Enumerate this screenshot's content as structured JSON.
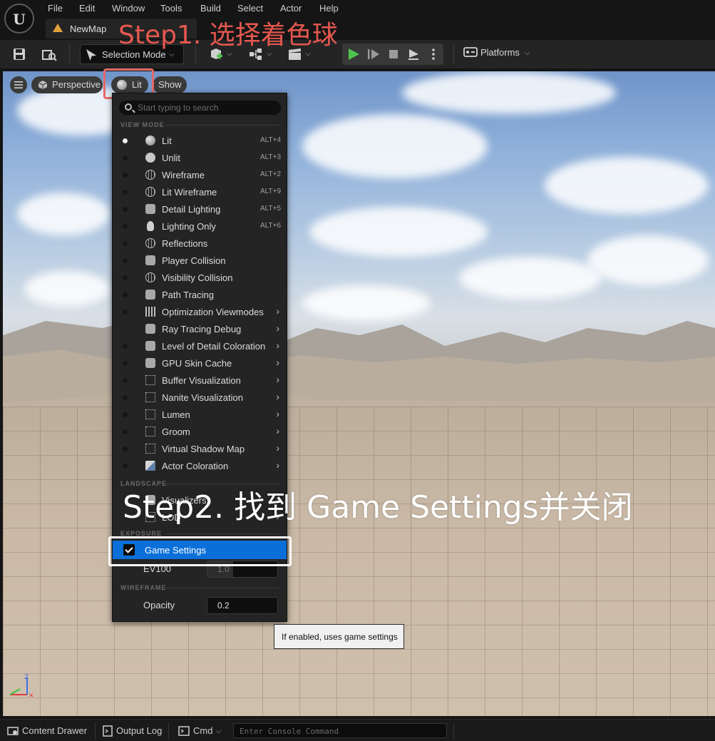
{
  "menubar": {
    "logo_letter": "U",
    "items": [
      "File",
      "Edit",
      "Window",
      "Tools",
      "Build",
      "Select",
      "Actor",
      "Help"
    ]
  },
  "tab": {
    "title": "NewMap"
  },
  "toolbar": {
    "selection_mode": "Selection Mode",
    "platforms": "Platforms",
    "icons": [
      "save-icon",
      "browse-icon",
      "add-actor-icon",
      "blueprint-icon",
      "cinematics-icon",
      "play-icon",
      "advance-icon",
      "stop-icon",
      "eject-icon",
      "more-icon",
      "platforms-icon"
    ]
  },
  "viewport": {
    "perspective": "Perspective",
    "lit": "Lit",
    "show": "Show"
  },
  "annotations": {
    "step1": "Step1. 选择着色球",
    "step2": "Step2. 找到 Game Settings并关闭"
  },
  "view_menu": {
    "search_placeholder": "Start typing to search",
    "sections": {
      "view_mode": "VIEW MODE",
      "landscape": "LANDSCAPE",
      "exposure": "EXPOSURE",
      "wireframe": "WIREFRAME"
    },
    "items": [
      {
        "label": "Lit",
        "shortcut": "ALT+4",
        "icon": "lit-sphere-icon",
        "selected": true
      },
      {
        "label": "Unlit",
        "shortcut": "ALT+3",
        "icon": "unlit-sphere-icon"
      },
      {
        "label": "Wireframe",
        "shortcut": "ALT+2",
        "icon": "wireframe-icon"
      },
      {
        "label": "Lit Wireframe",
        "shortcut": "ALT+9",
        "icon": "lit-wireframe-icon"
      },
      {
        "label": "Detail Lighting",
        "shortcut": "ALT+5",
        "icon": "detail-lighting-icon"
      },
      {
        "label": "Lighting Only",
        "shortcut": "ALT+6",
        "icon": "lightbulb-icon"
      },
      {
        "label": "Reflections",
        "shortcut": "",
        "icon": "reflections-icon"
      },
      {
        "label": "Player Collision",
        "shortcut": "",
        "icon": "player-collision-icon"
      },
      {
        "label": "Visibility Collision",
        "shortcut": "",
        "icon": "visibility-collision-icon"
      },
      {
        "label": "Path Tracing",
        "shortcut": "",
        "icon": "path-tracing-icon"
      },
      {
        "label": "Optimization Viewmodes",
        "shortcut": "",
        "icon": "optimization-icon",
        "submenu": true
      },
      {
        "label": "Ray Tracing Debug",
        "shortcut": "",
        "icon": "ray-tracing-icon",
        "submenu": true,
        "no_bullet": true
      },
      {
        "label": "Level of Detail Coloration",
        "shortcut": "",
        "icon": "lod-coloration-icon",
        "submenu": true
      },
      {
        "label": "GPU Skin Cache",
        "shortcut": "",
        "icon": "skin-cache-icon",
        "submenu": true
      },
      {
        "label": "Buffer Visualization",
        "shortcut": "",
        "icon": "buffer-icon",
        "submenu": true
      },
      {
        "label": "Nanite Visualization",
        "shortcut": "",
        "icon": "nanite-icon",
        "submenu": true
      },
      {
        "label": "Lumen",
        "shortcut": "",
        "icon": "lumen-icon",
        "submenu": true
      },
      {
        "label": "Groom",
        "shortcut": "",
        "icon": "groom-icon",
        "submenu": true
      },
      {
        "label": "Virtual Shadow Map",
        "shortcut": "",
        "icon": "shadow-map-icon",
        "submenu": true
      },
      {
        "label": "Actor Coloration",
        "shortcut": "",
        "icon": "actor-coloration-icon",
        "submenu": true
      }
    ],
    "landscape_items": [
      {
        "label": "Visualizers",
        "icon": "visualizers-icon",
        "submenu": true
      },
      {
        "label": "LOD",
        "icon": "lod-icon",
        "submenu": true
      }
    ],
    "game_settings": {
      "label": "Game Settings",
      "checked": true
    },
    "ev100": {
      "label": "EV100",
      "value": "1.0"
    },
    "opacity": {
      "label": "Opacity",
      "value": "0.2"
    }
  },
  "tooltip": "If enabled, uses game settings",
  "gizmo": {
    "z": "Z"
  },
  "statusbar": {
    "content_drawer": "Content Drawer",
    "output_log": "Output Log",
    "cmd": "Cmd",
    "console_placeholder": "Enter Console Command"
  },
  "colors": {
    "accent": "#0a6fd9",
    "annotation_red": "#e5584f",
    "play_green": "#4ec24e"
  }
}
